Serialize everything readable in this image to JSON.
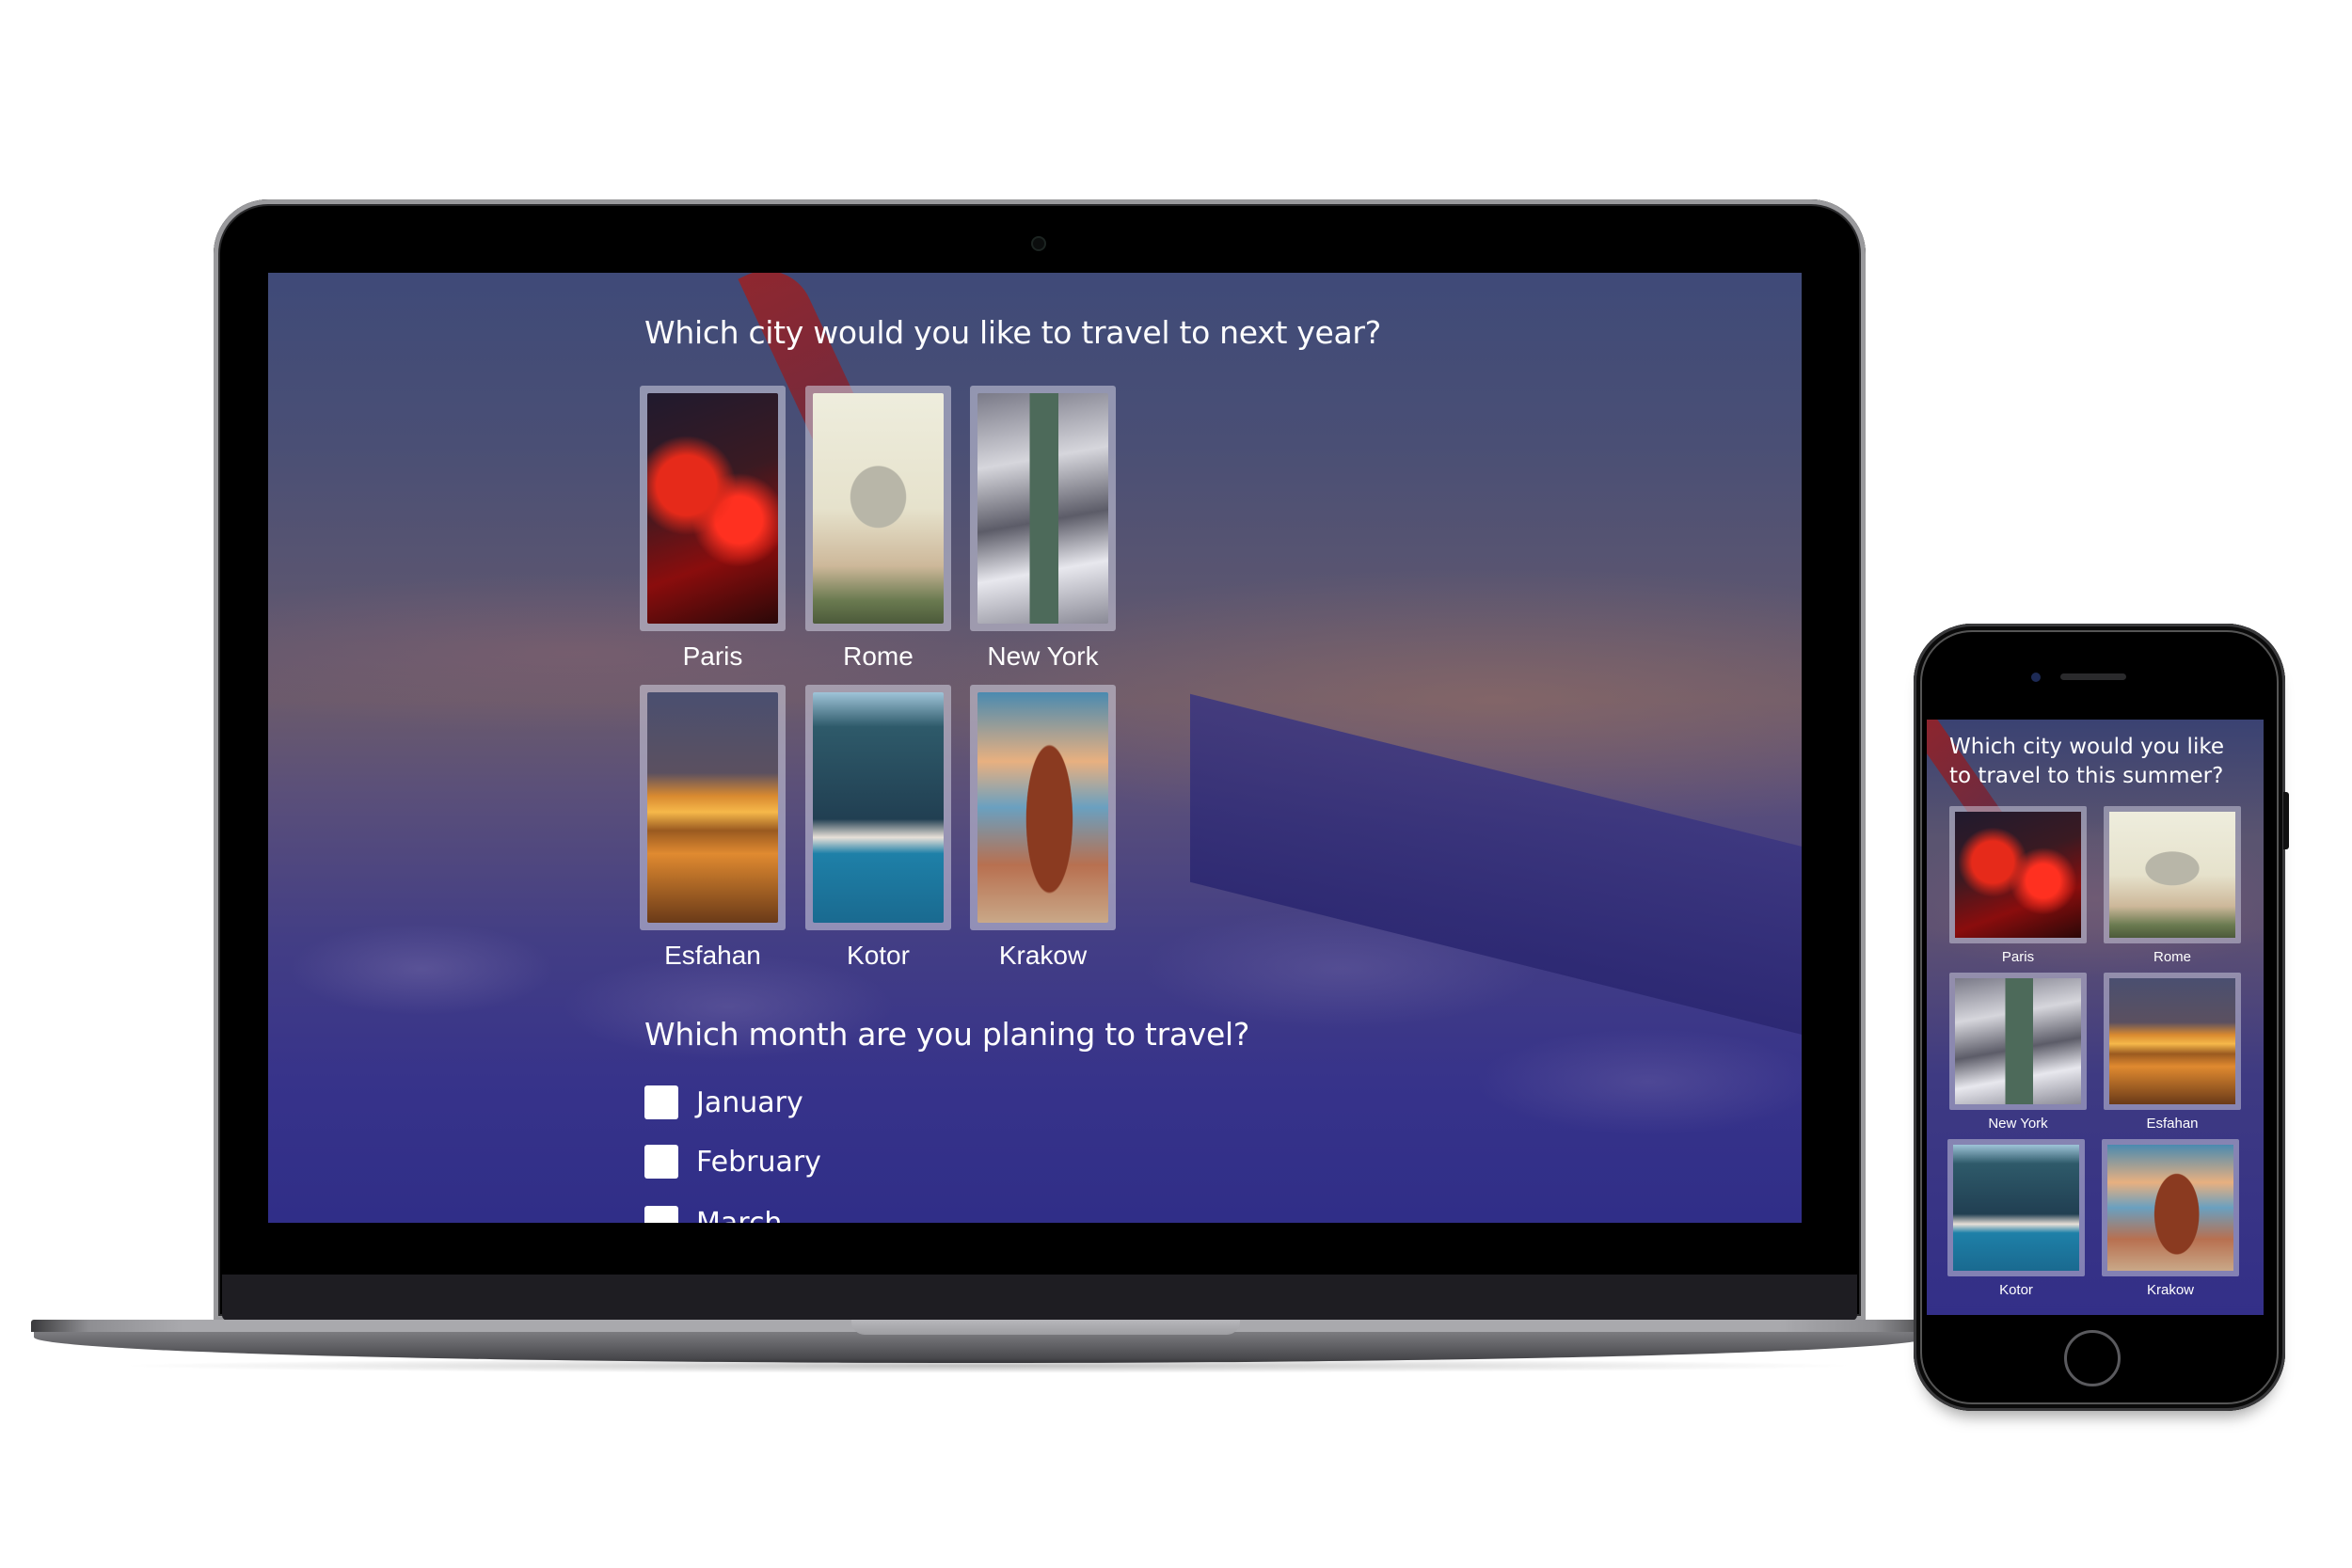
{
  "laptop": {
    "survey": {
      "city_question": "Which city would you like to travel to next year?",
      "cities": [
        {
          "label": "Paris",
          "image": "moulin-rouge-photo"
        },
        {
          "label": "Rome",
          "image": "st-peters-basilica-photo"
        },
        {
          "label": "New York",
          "image": "statue-of-liberty-photo"
        },
        {
          "label": "Esfahan",
          "image": "khaju-bridge-photo"
        },
        {
          "label": "Kotor",
          "image": "bay-of-kotor-photo"
        },
        {
          "label": "Krakow",
          "image": "st-marys-basilica-photo"
        }
      ],
      "month_question": "Which month are you planing to travel?",
      "months": [
        {
          "label": "January",
          "checked": false
        },
        {
          "label": "February",
          "checked": false
        },
        {
          "label": "March",
          "checked": false
        }
      ]
    }
  },
  "phone": {
    "survey": {
      "city_question": "Which city would you like to travel to this summer?",
      "cities": [
        {
          "label": "Paris",
          "image": "moulin-rouge-photo"
        },
        {
          "label": "Rome",
          "image": "st-peters-basilica-photo"
        },
        {
          "label": "New York",
          "image": "statue-of-liberty-photo"
        },
        {
          "label": "Esfahan",
          "image": "khaju-bridge-photo"
        },
        {
          "label": "Kotor",
          "image": "bay-of-kotor-photo"
        },
        {
          "label": "Krakow",
          "image": "st-marys-basilica-photo"
        }
      ]
    }
  },
  "colors": {
    "background_top": "#3f4a78",
    "background_bottom": "#302e88",
    "card_frame": "#d2d2e1",
    "text": "#ffffff"
  }
}
